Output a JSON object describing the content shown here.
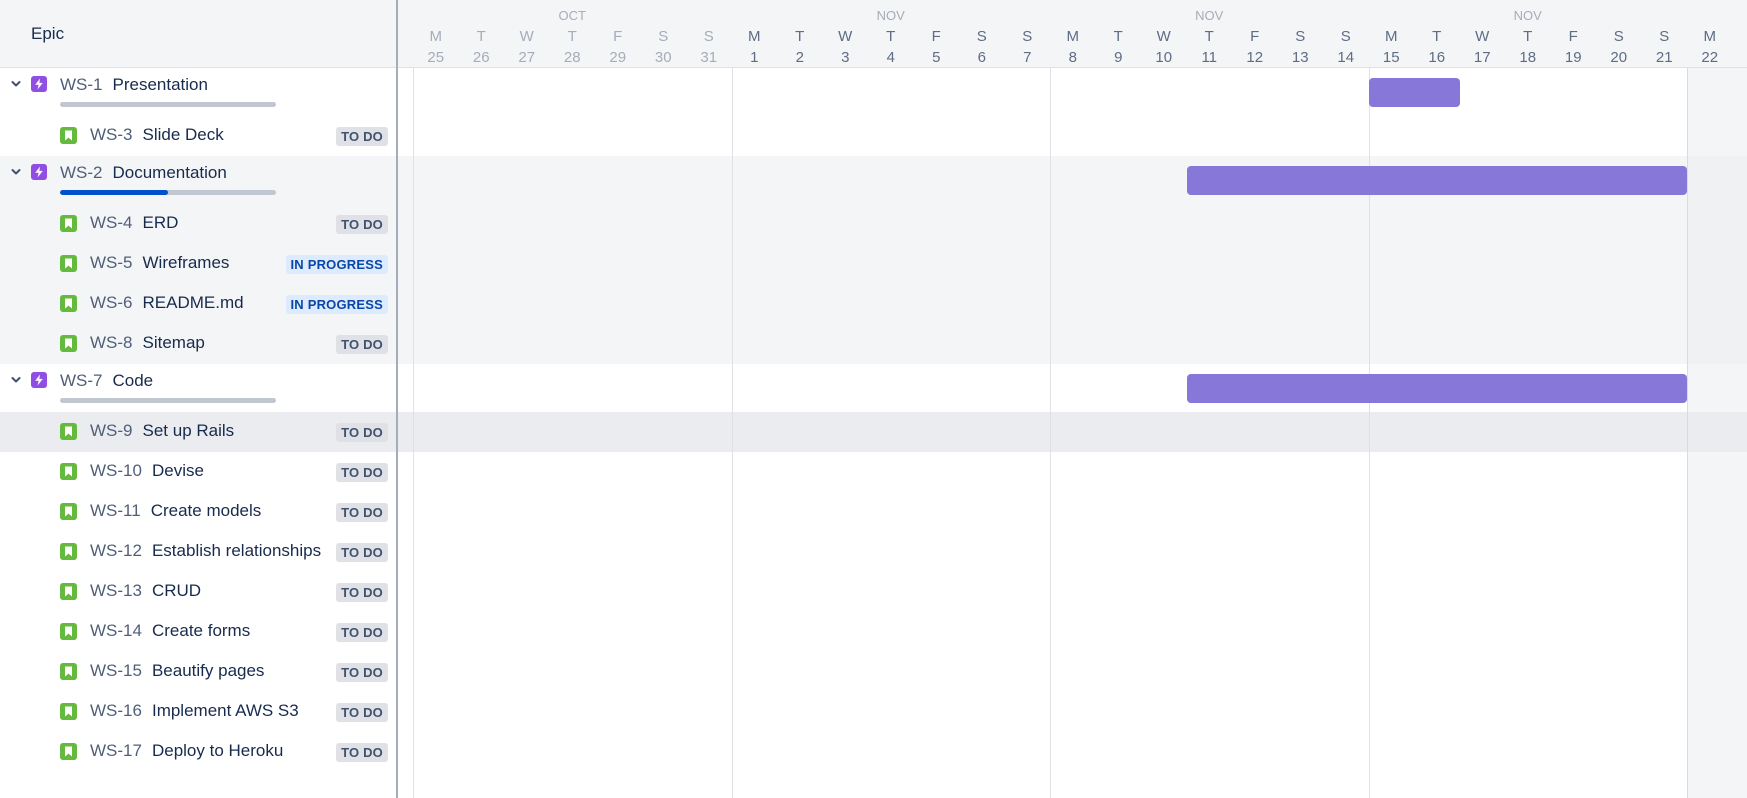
{
  "header": {
    "title": "Epic"
  },
  "months": [
    {
      "label": "OCT",
      "col": 3
    },
    {
      "label": "NOV",
      "col": 10
    },
    {
      "label": "NOV",
      "col": 17
    },
    {
      "label": "NOV",
      "col": 24
    }
  ],
  "days": [
    {
      "letter": "M",
      "num": "25"
    },
    {
      "letter": "T",
      "num": "26"
    },
    {
      "letter": "W",
      "num": "27"
    },
    {
      "letter": "T",
      "num": "28"
    },
    {
      "letter": "F",
      "num": "29"
    },
    {
      "letter": "S",
      "num": "30"
    },
    {
      "letter": "S",
      "num": "31"
    },
    {
      "letter": "M",
      "num": "1"
    },
    {
      "letter": "T",
      "num": "2"
    },
    {
      "letter": "W",
      "num": "3"
    },
    {
      "letter": "T",
      "num": "4"
    },
    {
      "letter": "F",
      "num": "5"
    },
    {
      "letter": "S",
      "num": "6"
    },
    {
      "letter": "S",
      "num": "7"
    },
    {
      "letter": "M",
      "num": "8"
    },
    {
      "letter": "T",
      "num": "9"
    },
    {
      "letter": "W",
      "num": "10"
    },
    {
      "letter": "T",
      "num": "11"
    },
    {
      "letter": "F",
      "num": "12"
    },
    {
      "letter": "S",
      "num": "13"
    },
    {
      "letter": "S",
      "num": "14"
    },
    {
      "letter": "M",
      "num": "15"
    },
    {
      "letter": "T",
      "num": "16"
    },
    {
      "letter": "W",
      "num": "17"
    },
    {
      "letter": "T",
      "num": "18"
    },
    {
      "letter": "F",
      "num": "19"
    },
    {
      "letter": "S",
      "num": "20"
    },
    {
      "letter": "S",
      "num": "21"
    },
    {
      "letter": "M",
      "num": "22"
    }
  ],
  "past_days": 7,
  "epics": [
    {
      "key": "WS-1",
      "name": "Presentation",
      "progress": 0,
      "bar": {
        "start": 21,
        "end": 23
      },
      "children": [
        {
          "key": "WS-3",
          "name": "Slide Deck",
          "status": "TO DO",
          "status_type": "todo"
        }
      ]
    },
    {
      "key": "WS-2",
      "name": "Documentation",
      "progress": 0.5,
      "bar": {
        "start": 17,
        "end": 28
      },
      "children": [
        {
          "key": "WS-4",
          "name": "ERD",
          "status": "TO DO",
          "status_type": "todo"
        },
        {
          "key": "WS-5",
          "name": "Wireframes",
          "status": "IN PROGRESS",
          "status_type": "inprogress"
        },
        {
          "key": "WS-6",
          "name": "README.md",
          "status": "IN PROGRESS",
          "status_type": "inprogress"
        },
        {
          "key": "WS-8",
          "name": "Sitemap",
          "status": "TO DO",
          "status_type": "todo"
        }
      ]
    },
    {
      "key": "WS-7",
      "name": "Code",
      "progress": 0,
      "bar": {
        "start": 17,
        "end": 28
      },
      "children": [
        {
          "key": "WS-9",
          "name": "Set up Rails",
          "status": "TO DO",
          "status_type": "todo",
          "selected": true
        },
        {
          "key": "WS-10",
          "name": "Devise",
          "status": "TO DO",
          "status_type": "todo"
        },
        {
          "key": "WS-11",
          "name": "Create models",
          "status": "TO DO",
          "status_type": "todo"
        },
        {
          "key": "WS-12",
          "name": "Establish relationships",
          "status": "TO DO",
          "status_type": "todo"
        },
        {
          "key": "WS-13",
          "name": "CRUD",
          "status": "TO DO",
          "status_type": "todo"
        },
        {
          "key": "WS-14",
          "name": "Create forms",
          "status": "TO DO",
          "status_type": "todo"
        },
        {
          "key": "WS-15",
          "name": "Beautify pages",
          "status": "TO DO",
          "status_type": "todo"
        },
        {
          "key": "WS-16",
          "name": "Implement AWS S3",
          "status": "TO DO",
          "status_type": "todo"
        },
        {
          "key": "WS-17",
          "name": "Deploy to Heroku",
          "status": "TO DO",
          "status_type": "todo"
        }
      ]
    }
  ],
  "colors": {
    "epic_icon": "#904ee2",
    "story_icon": "#63ba3c",
    "bar": "#8777d9",
    "progress_fill": "#0052cc",
    "alt_row": "#f4f5f7",
    "selected_row": "#ebecf0"
  },
  "icons": {
    "expand": "chevron-down-icon",
    "epic": "lightning-icon",
    "story": "bookmark-icon"
  }
}
